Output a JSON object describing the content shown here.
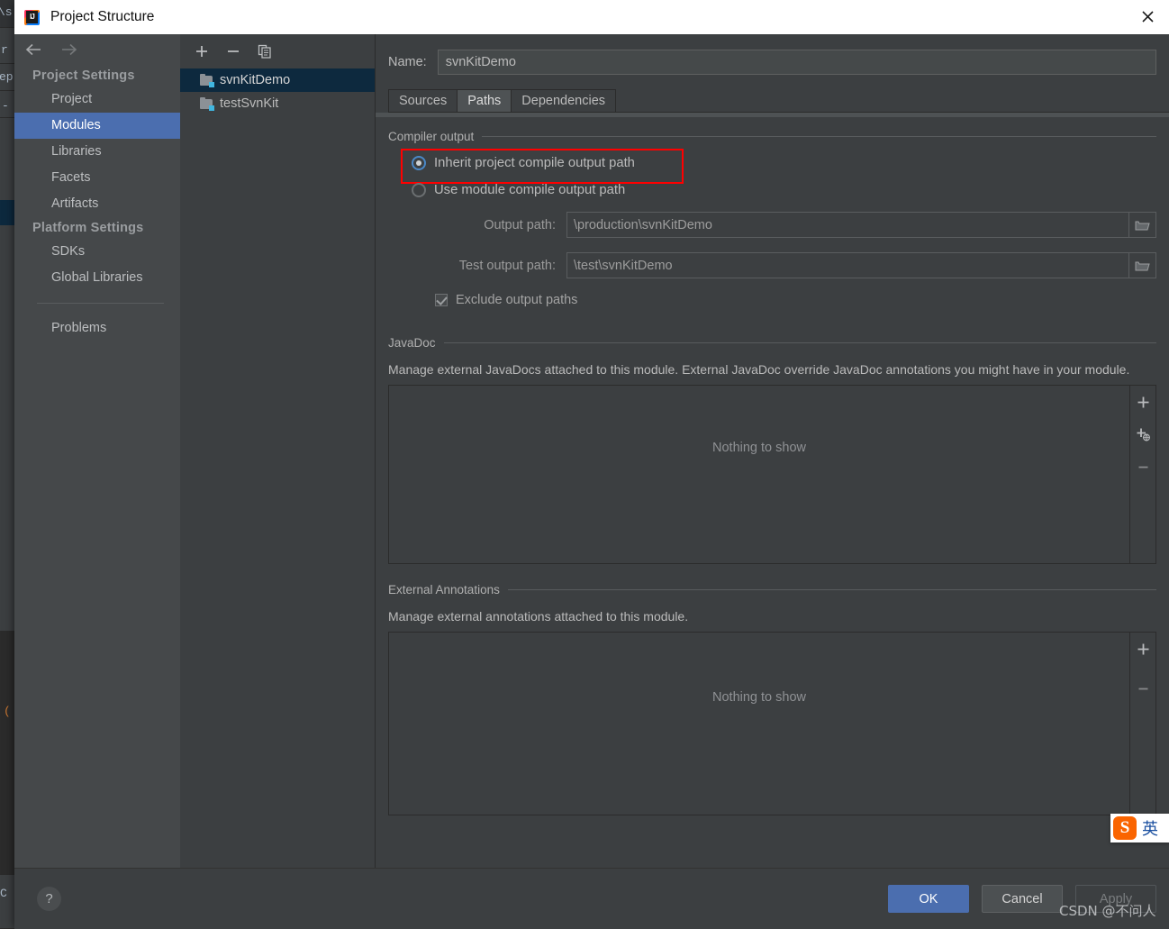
{
  "window": {
    "title": "Project Structure",
    "app_icon": "intellij-idea-icon",
    "close_icon": "close-icon"
  },
  "sidebar": {
    "back_icon": "arrow-left-icon",
    "forward_icon": "arrow-right-icon",
    "groups": [
      {
        "label": "Project Settings",
        "items": [
          {
            "label": "Project",
            "selected": false
          },
          {
            "label": "Modules",
            "selected": true
          },
          {
            "label": "Libraries",
            "selected": false
          },
          {
            "label": "Facets",
            "selected": false
          },
          {
            "label": "Artifacts",
            "selected": false
          }
        ]
      },
      {
        "label": "Platform Settings",
        "items": [
          {
            "label": "SDKs",
            "selected": false
          },
          {
            "label": "Global Libraries",
            "selected": false
          }
        ]
      }
    ],
    "extra": [
      {
        "label": "Problems",
        "selected": false
      }
    ]
  },
  "modules_panel": {
    "toolbar": [
      {
        "name": "add-module-button",
        "glyph": "+"
      },
      {
        "name": "remove-module-button",
        "glyph": "−"
      },
      {
        "name": "copy-module-button",
        "glyph": "copy-icon"
      }
    ],
    "items": [
      {
        "label": "svnKitDemo",
        "selected": true
      },
      {
        "label": "testSvnKit",
        "selected": false
      }
    ]
  },
  "main": {
    "name_label": "Name:",
    "name_value": "svnKitDemo",
    "tabs": [
      {
        "label": "Sources",
        "active": false
      },
      {
        "label": "Paths",
        "active": true
      },
      {
        "label": "Dependencies",
        "active": false
      }
    ],
    "compiler_output": {
      "group_label": "Compiler output",
      "radios": [
        {
          "label": "Inherit project compile output path",
          "checked": true,
          "highlighted": true
        },
        {
          "label": "Use module compile output path",
          "checked": false,
          "highlighted": false
        }
      ],
      "fields": [
        {
          "label": "Output path:",
          "value": "\\production\\svnKitDemo",
          "browse_icon": "folder-icon"
        },
        {
          "label": "Test output path:",
          "value": "\\test\\svnKitDemo",
          "browse_icon": "folder-icon"
        }
      ],
      "checkbox": {
        "label": "Exclude output paths",
        "checked": true
      }
    },
    "javadoc": {
      "group_label": "JavaDoc",
      "description": "Manage external JavaDocs attached to this module. External JavaDoc override JavaDoc annotations you might have in your module.",
      "empty_text": "Nothing to show",
      "buttons": [
        {
          "name": "add-javadoc-button",
          "glyph": "+"
        },
        {
          "name": "add-javadoc-url-button",
          "glyph": "+globe"
        },
        {
          "name": "remove-javadoc-button",
          "glyph": "−"
        }
      ]
    },
    "external_annotations": {
      "group_label": "External Annotations",
      "description": "Manage external annotations attached to this module.",
      "empty_text": "Nothing to show",
      "buttons": [
        {
          "name": "add-annotation-button",
          "glyph": "+"
        },
        {
          "name": "remove-annotation-button",
          "glyph": "−"
        }
      ]
    }
  },
  "footer": {
    "help_label": "?",
    "ok_label": "OK",
    "cancel_label": "Cancel",
    "apply_label": "Apply"
  },
  "overlays": {
    "ime_logo": "S",
    "ime_mode": "英",
    "watermark": "CSDN @不问人"
  },
  "colors": {
    "accent_blue": "#4b6eaf",
    "selection_navy": "#0d293e",
    "highlight_red": "#ff0000",
    "panel_bg": "#3c3f41",
    "sidebar_bg": "#45484a"
  }
}
